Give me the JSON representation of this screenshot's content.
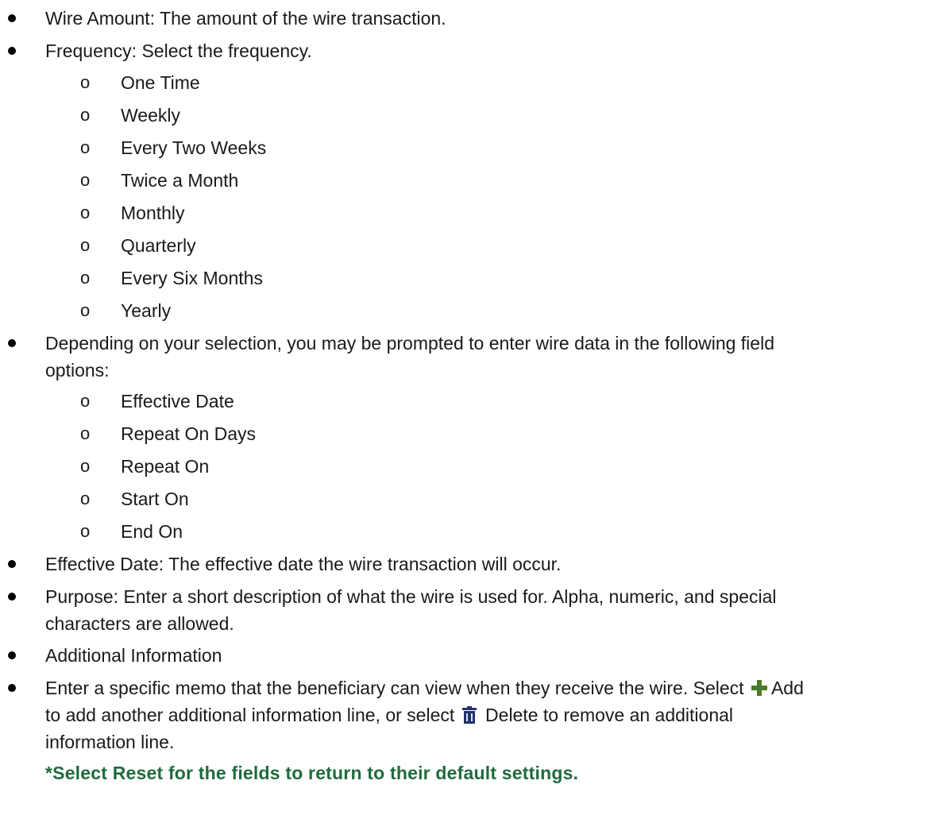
{
  "bullets": {
    "wire_amount": "Wire Amount: The amount of the wire transaction.",
    "frequency": "Frequency: Select the frequency.",
    "depending_line1": "Depending on your selection, you may be prompted to enter wire data in the following field",
    "depending_line2": "options:",
    "effective_date": "Effective Date: The effective date the wire transaction will occur.",
    "purpose_line1": "Purpose: Enter a short description of what the wire is used for. Alpha, numeric, and special",
    "purpose_line2": "characters are allowed.",
    "additional_information": "Additional Information",
    "memo_part1": "Enter a specific memo that the beneficiary can view when they receive the wire. Select",
    "memo_part2": "Add",
    "memo_part3": "to add another additional information line, or select",
    "memo_part4": "Delete to remove an additional",
    "memo_part5": "information line.",
    "reset_note": "*Select Reset for the fields to return to their default settings."
  },
  "frequency_options": [
    "One Time",
    "Weekly",
    "Every Two Weeks",
    "Twice a Month",
    "Monthly",
    "Quarterly",
    "Every Six Months",
    "Yearly"
  ],
  "field_options": [
    "Effective Date",
    "Repeat On Days",
    "Repeat On",
    "Start On",
    "End On"
  ],
  "sub_marker": "o",
  "icons": {
    "add": "plus-icon",
    "delete": "trash-icon"
  },
  "colors": {
    "note": "#1f6b3d",
    "plus": "#4a7a2c",
    "trash": "#22336e"
  }
}
